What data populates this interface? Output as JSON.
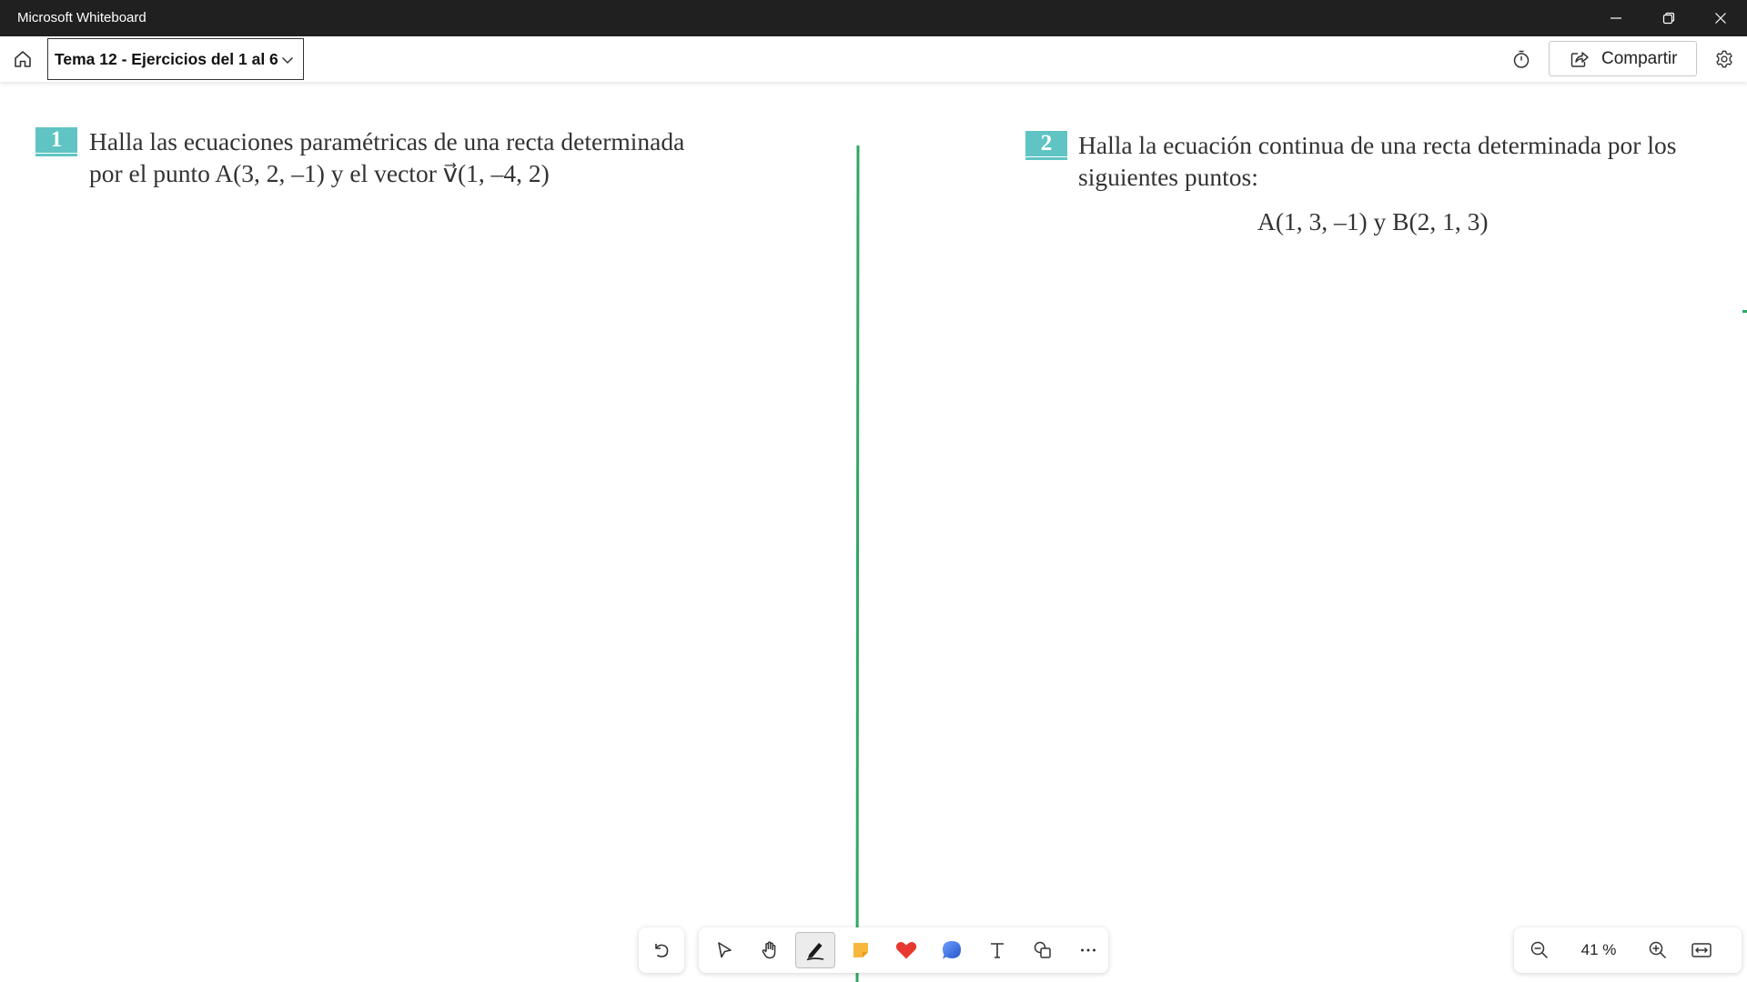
{
  "window": {
    "title": "Microsoft Whiteboard"
  },
  "toolbar": {
    "board_title": "Tema 12 - Ejercicios del 1 al 6",
    "share_label": "Compartir"
  },
  "canvas": {
    "exercises": [
      {
        "number": "1",
        "lines": [
          "Halla las ecuaciones paramétricas de una recta determinada",
          "por el punto A(3, 2, –1) y el vector v⃗(1, –4, 2)"
        ]
      },
      {
        "number": "2",
        "lines": [
          "Halla la ecuación continua de una recta determinada por los",
          "siguientes puntos:"
        ],
        "formula": "A(1, 3, –1) y B(2, 1, 3)"
      }
    ],
    "divider_color": "#2fa862",
    "badge_color": "#5fc4c3"
  },
  "palette": {
    "tools": [
      "undo-icon",
      "select-icon",
      "hand-icon",
      "pen-icon",
      "sticky-note-icon",
      "heart-reaction-icon",
      "chat-bubble-icon",
      "text-icon",
      "shapes-icon",
      "more-icon"
    ],
    "active_tool": "pen-icon"
  },
  "zoom": {
    "level": "41 %"
  }
}
